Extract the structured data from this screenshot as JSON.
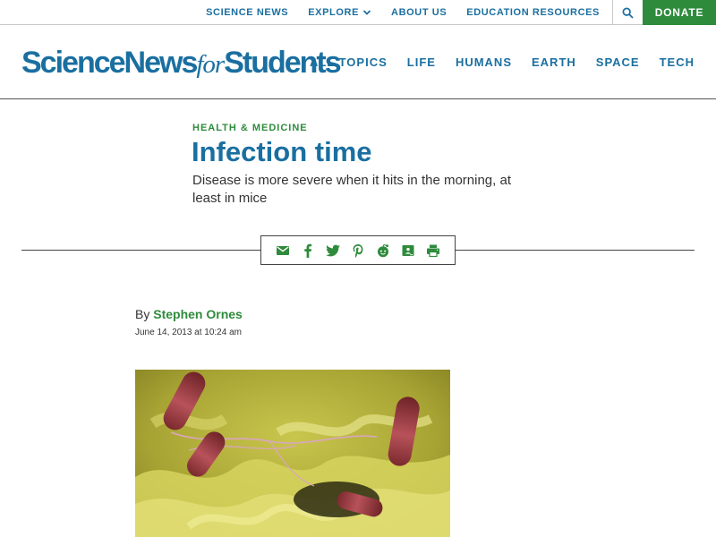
{
  "topnav": {
    "science_news": "SCIENCE NEWS",
    "explore": "EXPLORE",
    "about_us": "ABOUT US",
    "education_resources": "EDUCATION RESOURCES",
    "donate": "DONATE"
  },
  "logo": {
    "part1": "ScienceNews",
    "part2": "for",
    "part3": "Students"
  },
  "mainnav": [
    "ALL TOPICS",
    "LIFE",
    "HUMANS",
    "EARTH",
    "SPACE",
    "TECH"
  ],
  "article": {
    "kicker": "HEALTH & MEDICINE",
    "title": "Infection time",
    "dek": "Disease is more severe when it hits in the morning, at least in mice",
    "by_prefix": "By",
    "author": "Stephen Ornes",
    "date": "June 14, 2013 at 10:24 am"
  },
  "share_icons": [
    "email-icon",
    "facebook-icon",
    "twitter-icon",
    "pinterest-icon",
    "reddit-icon",
    "google-classroom-icon",
    "print-icon"
  ],
  "colors": {
    "blue": "#1a6fa0",
    "green": "#2e8b3c"
  }
}
